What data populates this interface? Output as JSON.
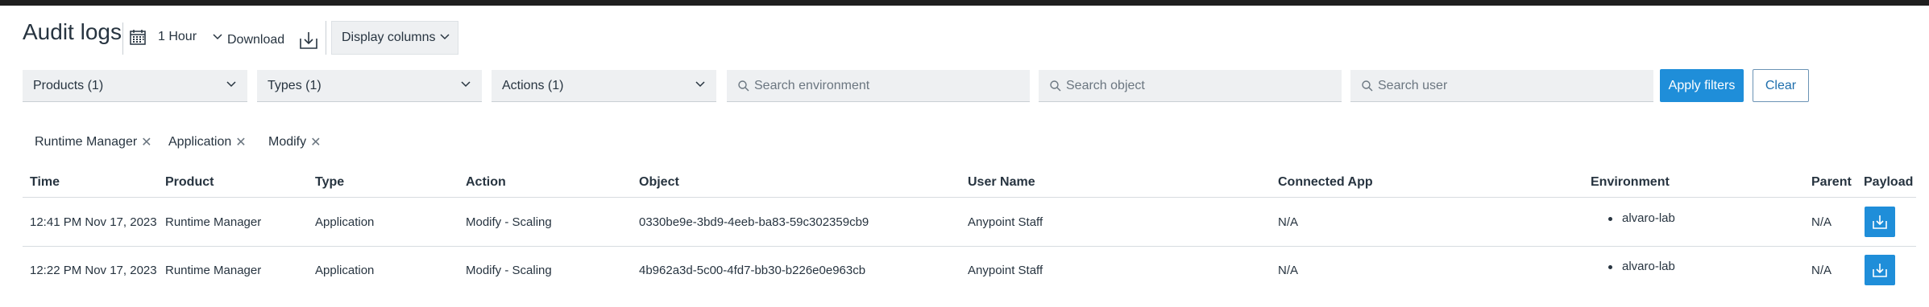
{
  "header": {
    "title": "Audit logs",
    "time_range": "1 Hour",
    "download_label": "Download",
    "display_columns_label": "Display columns"
  },
  "filters": {
    "products": "Products (1)",
    "types": "Types (1)",
    "actions": "Actions (1)",
    "search_environment_placeholder": "Search environment",
    "search_object_placeholder": "Search object",
    "search_user_placeholder": "Search user",
    "apply_label": "Apply filters",
    "clear_label": "Clear"
  },
  "active_filters": [
    "Runtime Manager",
    "Application",
    "Modify"
  ],
  "table": {
    "columns": [
      "Time",
      "Product",
      "Type",
      "Action",
      "Object",
      "User Name",
      "Connected App",
      "Environment",
      "Parent",
      "Payload"
    ],
    "rows": [
      {
        "time": "12:41 PM Nov 17, 2023",
        "product": "Runtime Manager",
        "type": "Application",
        "action": "Modify - Scaling",
        "object": "0330be9e-3bd9-4eeb-ba83-59c302359cb9",
        "user_name": "Anypoint Staff",
        "connected_app": "N/A",
        "environment": "alvaro-lab",
        "parent": "N/A"
      },
      {
        "time": "12:22 PM Nov 17, 2023",
        "product": "Runtime Manager",
        "type": "Application",
        "action": "Modify - Scaling",
        "object": "4b962a3d-5c00-4fd7-bb30-b226e0e963cb",
        "user_name": "Anypoint Staff",
        "connected_app": "N/A",
        "environment": "alvaro-lab",
        "parent": "N/A"
      }
    ]
  },
  "icons": {
    "calendar": "calendar-icon",
    "chevron": "chevron-down-icon",
    "download": "download-tray-icon",
    "search": "search-icon",
    "close": "close-icon"
  },
  "colors": {
    "accent": "#1f8ed9",
    "text": "#273440",
    "field_bg": "#eef0f2"
  }
}
